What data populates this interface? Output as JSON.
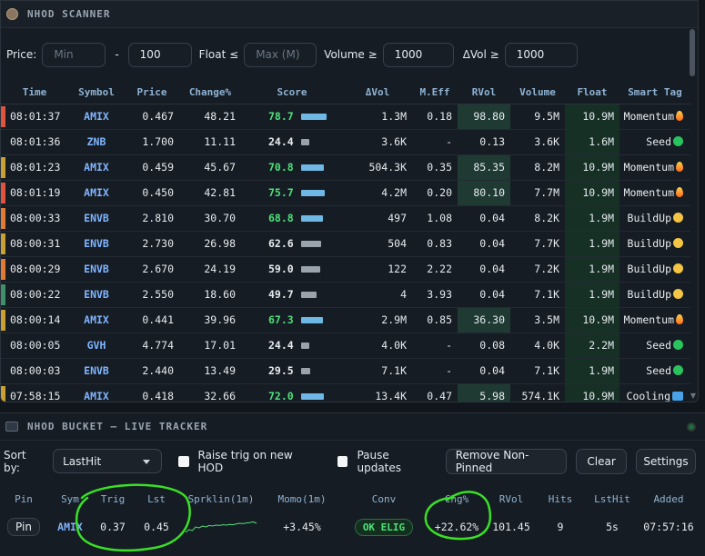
{
  "scanner": {
    "title": "NHOD SCANNER",
    "filters": {
      "price_label": "Price:",
      "price_min_placeholder": "Min",
      "dash": "-",
      "price_max_value": "100",
      "float_label": "Float ≤",
      "float_placeholder": "Max (M)",
      "volume_label": "Volume ≥",
      "volume_value": "1000",
      "dvol_label": "ΔVol ≥",
      "dvol_value": "1000"
    },
    "columns": [
      "Time",
      "Symbol",
      "Price",
      "Change%",
      "Score",
      "ΔVol",
      "M.Eff",
      "RVol",
      "Volume",
      "Float",
      "Smart Tag"
    ],
    "rows": [
      {
        "time": "08:01:37",
        "symbol": "AMIX",
        "price": "0.467",
        "change": "48.21",
        "score": "78.7",
        "score_level": 78.7,
        "score_hot": true,
        "dvol": "1.3M",
        "meff": "0.18",
        "rvol": "98.80",
        "rvol_hi": true,
        "volume": "9.5M",
        "float": "10.9M",
        "tag": "Momentum",
        "tag_icon": "flame-icon",
        "edge_color": "#e0533f"
      },
      {
        "time": "08:01:36",
        "symbol": "ZNB",
        "price": "1.700",
        "change": "11.11",
        "score": "24.4",
        "score_level": 24.4,
        "score_hot": false,
        "dvol": "3.6K",
        "meff": "-",
        "rvol": "0.13",
        "rvol_hi": false,
        "volume": "3.6K",
        "float": "1.6M",
        "tag": "Seed",
        "tag_icon": "green-dot-icon",
        "edge_color": ""
      },
      {
        "time": "08:01:23",
        "symbol": "AMIX",
        "price": "0.459",
        "change": "45.67",
        "score": "70.8",
        "score_level": 70.8,
        "score_hot": true,
        "dvol": "504.3K",
        "meff": "0.35",
        "rvol": "85.35",
        "rvol_hi": true,
        "volume": "8.2M",
        "float": "10.9M",
        "tag": "Momentum",
        "tag_icon": "flame-icon",
        "edge_color": "#c9a033"
      },
      {
        "time": "08:01:19",
        "symbol": "AMIX",
        "price": "0.450",
        "change": "42.81",
        "score": "75.7",
        "score_level": 75.7,
        "score_hot": true,
        "dvol": "4.2M",
        "meff": "0.20",
        "rvol": "80.10",
        "rvol_hi": true,
        "volume": "7.7M",
        "float": "10.9M",
        "tag": "Momentum",
        "tag_icon": "flame-icon",
        "edge_color": "#e0533f"
      },
      {
        "time": "08:00:33",
        "symbol": "ENVB",
        "price": "2.810",
        "change": "30.70",
        "score": "68.8",
        "score_level": 68.8,
        "score_hot": true,
        "dvol": "497",
        "meff": "1.08",
        "rvol": "0.04",
        "rvol_hi": false,
        "volume": "8.2K",
        "float": "1.9M",
        "tag": "BuildUp",
        "tag_icon": "yellow-dot-icon",
        "edge_color": "#e07a35"
      },
      {
        "time": "08:00:31",
        "symbol": "ENVB",
        "price": "2.730",
        "change": "26.98",
        "score": "62.6",
        "score_level": 62.6,
        "score_hot": false,
        "dvol": "504",
        "meff": "0.83",
        "rvol": "0.04",
        "rvol_hi": false,
        "volume": "7.7K",
        "float": "1.9M",
        "tag": "BuildUp",
        "tag_icon": "yellow-dot-icon",
        "edge_color": "#c9a033"
      },
      {
        "time": "08:00:29",
        "symbol": "ENVB",
        "price": "2.670",
        "change": "24.19",
        "score": "59.0",
        "score_level": 59.0,
        "score_hot": false,
        "dvol": "122",
        "meff": "2.22",
        "rvol": "0.04",
        "rvol_hi": false,
        "volume": "7.2K",
        "float": "1.9M",
        "tag": "BuildUp",
        "tag_icon": "yellow-dot-icon",
        "edge_color": "#e07a35"
      },
      {
        "time": "08:00:22",
        "symbol": "ENVB",
        "price": "2.550",
        "change": "18.60",
        "score": "49.7",
        "score_level": 49.7,
        "score_hot": false,
        "dvol": "4",
        "meff": "3.93",
        "rvol": "0.04",
        "rvol_hi": false,
        "volume": "7.1K",
        "float": "1.9M",
        "tag": "BuildUp",
        "tag_icon": "yellow-dot-icon",
        "edge_color": "#3f8f6a"
      },
      {
        "time": "08:00:14",
        "symbol": "AMIX",
        "price": "0.441",
        "change": "39.96",
        "score": "67.3",
        "score_level": 67.3,
        "score_hot": true,
        "dvol": "2.9M",
        "meff": "0.85",
        "rvol": "36.30",
        "rvol_hi": true,
        "volume": "3.5M",
        "float": "10.9M",
        "tag": "Momentum",
        "tag_icon": "flame-icon",
        "edge_color": "#c9a033"
      },
      {
        "time": "08:00:05",
        "symbol": "GVH",
        "price": "4.774",
        "change": "17.01",
        "score": "24.4",
        "score_level": 24.4,
        "score_hot": false,
        "dvol": "4.0K",
        "meff": "-",
        "rvol": "0.08",
        "rvol_hi": false,
        "volume": "4.0K",
        "float": "2.2M",
        "tag": "Seed",
        "tag_icon": "green-dot-icon",
        "edge_color": ""
      },
      {
        "time": "08:00:03",
        "symbol": "ENVB",
        "price": "2.440",
        "change": "13.49",
        "score": "29.5",
        "score_level": 29.5,
        "score_hot": false,
        "dvol": "7.1K",
        "meff": "-",
        "rvol": "0.04",
        "rvol_hi": false,
        "volume": "7.1K",
        "float": "1.9M",
        "tag": "Seed",
        "tag_icon": "green-dot-icon",
        "edge_color": ""
      },
      {
        "time": "07:58:15",
        "symbol": "AMIX",
        "price": "0.418",
        "change": "32.66",
        "score": "72.0",
        "score_level": 72.0,
        "score_hot": true,
        "dvol": "13.4K",
        "meff": "0.47",
        "rvol": "5.98",
        "rvol_hi": true,
        "volume": "574.1K",
        "float": "10.9M",
        "tag": "Cooling",
        "tag_icon": "blue-square-icon",
        "edge_color": "#c9a033"
      }
    ]
  },
  "bucket": {
    "title": "NHOD BUCKET — LIVE TRACKER",
    "sort_label": "Sort by:",
    "sort_value": "LastHit",
    "raise_trig_label": "Raise trig on new HOD",
    "pause_label": "Pause updates",
    "remove_label": "Remove Non-Pinned",
    "clear_label": "Clear",
    "settings_label": "Settings",
    "columns": [
      "Pin",
      "Sym",
      "Trig",
      "Lst",
      "Sprklin(1m)",
      "Momo(1m)",
      "Conv",
      "Chg%",
      "RVol",
      "Hits",
      "LstHit",
      "Added"
    ],
    "rows": [
      {
        "pin": "Pin",
        "sym": "AMIX",
        "trig": "0.37",
        "last": "0.45",
        "sparkline": [
          0.2,
          0.35,
          0.3,
          0.5,
          0.45,
          0.55,
          0.5,
          0.58,
          0.55,
          0.6,
          0.58,
          0.62,
          0.6,
          0.64,
          0.62,
          0.66,
          0.7,
          0.68,
          0.72,
          0.74,
          0.78,
          0.7
        ],
        "momo": "+3.45%",
        "conv": "OK ELIG",
        "chg": "+22.62%",
        "rvol": "101.45",
        "hits": "9",
        "lsthit": "5s",
        "added": "07:57:16"
      }
    ]
  },
  "colors": {
    "hot_score": "#4de07a",
    "bar_hot": "#6fb8e6",
    "bar_cool": "#9aa3ab",
    "annotation": "#39e026"
  }
}
